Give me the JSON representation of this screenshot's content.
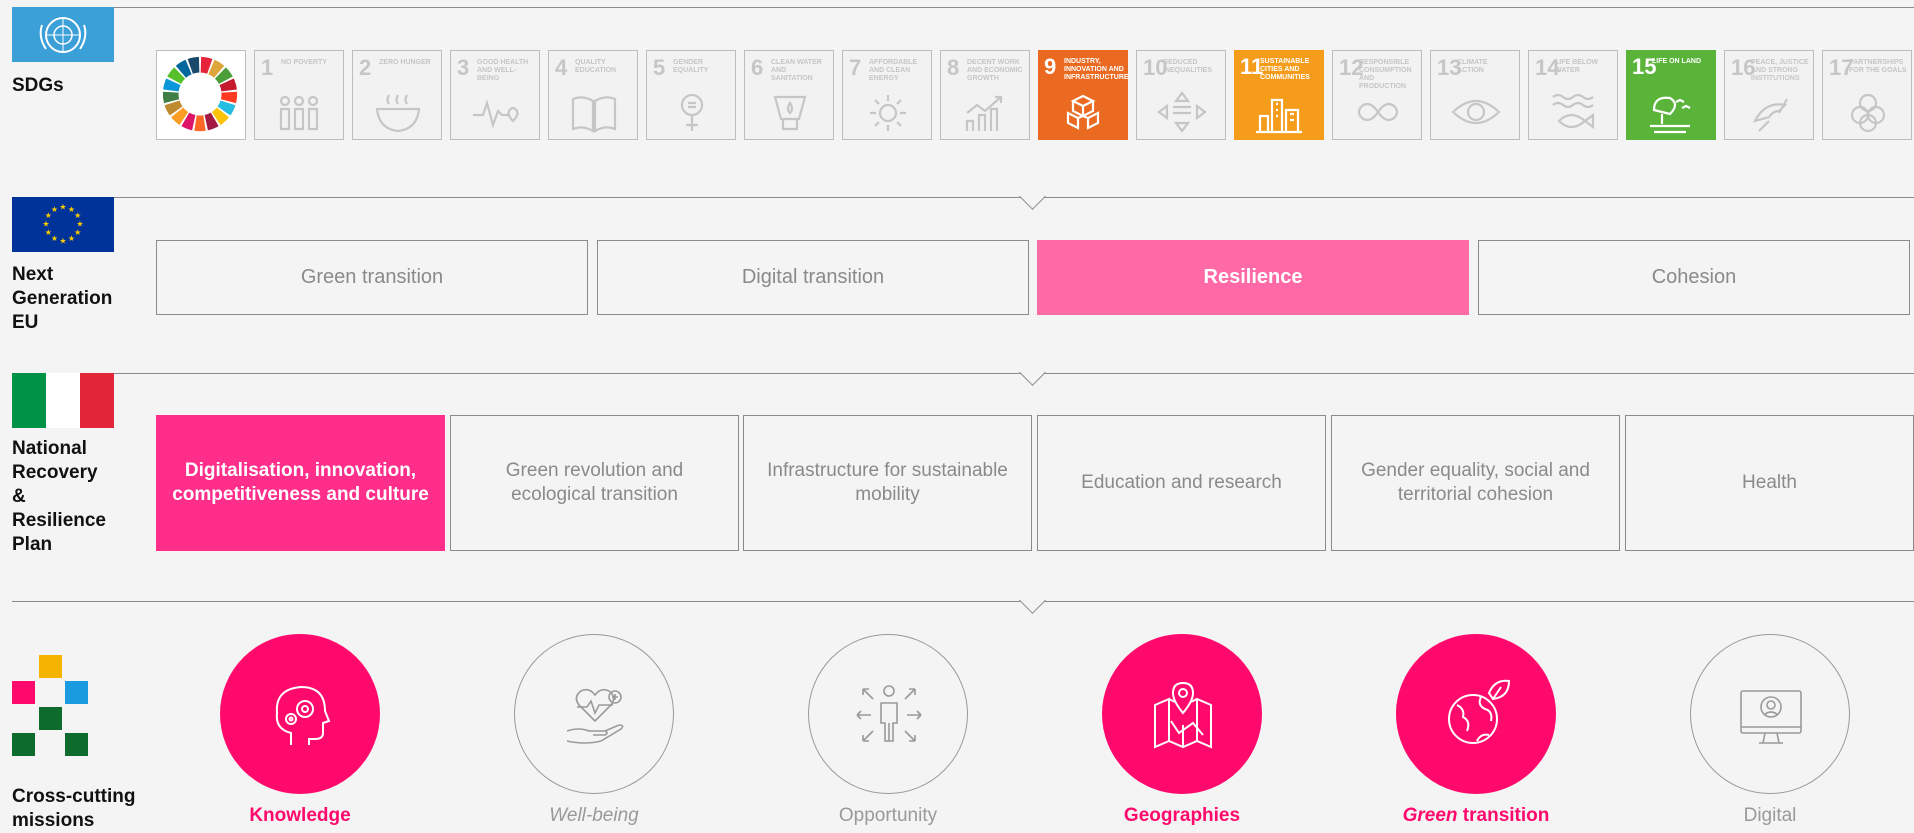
{
  "sections": {
    "sdgs": "SDGs",
    "ngeu": [
      "Next",
      "Generation",
      "EU"
    ],
    "pnrr": [
      "National",
      "Recovery",
      "&",
      "Resilience",
      "Plan"
    ],
    "missions": [
      "Cross-cutting",
      "missions"
    ]
  },
  "sdg_tiles": [
    {
      "num": "1",
      "title": "No poverty",
      "active": false
    },
    {
      "num": "2",
      "title": "Zero hunger",
      "active": false
    },
    {
      "num": "3",
      "title": "Good health and well-being",
      "active": false
    },
    {
      "num": "4",
      "title": "Quality education",
      "active": false
    },
    {
      "num": "5",
      "title": "Gender equality",
      "active": false
    },
    {
      "num": "6",
      "title": "Clean water and sanitation",
      "active": false
    },
    {
      "num": "7",
      "title": "Affordable and clean energy",
      "active": false
    },
    {
      "num": "8",
      "title": "Decent work and economic growth",
      "active": false
    },
    {
      "num": "9",
      "title": "Industry, innovation and infrastructure",
      "active": true,
      "color": "#eb6a22"
    },
    {
      "num": "10",
      "title": "Reduced inequalities",
      "active": false
    },
    {
      "num": "11",
      "title": "Sustainable cities and communities",
      "active": true,
      "color": "#f59c1b"
    },
    {
      "num": "12",
      "title": "Responsible consumption and production",
      "active": false
    },
    {
      "num": "13",
      "title": "Climate action",
      "active": false
    },
    {
      "num": "14",
      "title": "Life below water",
      "active": false
    },
    {
      "num": "15",
      "title": "Life on land",
      "active": true,
      "color": "#5bb43a"
    },
    {
      "num": "16",
      "title": "Peace, justice and strong institutions",
      "active": false
    },
    {
      "num": "17",
      "title": "Partnerships for the goals",
      "active": false
    }
  ],
  "ngeu_items": [
    {
      "label": "Green transition",
      "active": false
    },
    {
      "label": "Digital transition",
      "active": false
    },
    {
      "label": "Resilience",
      "active": true
    },
    {
      "label": "Cohesion",
      "active": false
    }
  ],
  "pnrr_items": [
    {
      "label": "Digitalisation, innovation, competitiveness and culture",
      "active": true
    },
    {
      "label": "Green revolution and ecological transition",
      "active": false
    },
    {
      "label": "Infrastructure for sustainable mobility",
      "active": false
    },
    {
      "label": "Education and research",
      "active": false
    },
    {
      "label": "Gender equality, social and territorial cohesion",
      "active": false
    },
    {
      "label": "Health",
      "active": false
    }
  ],
  "missions": [
    {
      "label": "Knowledge",
      "icon": "head-gears-icon",
      "active": true
    },
    {
      "label": "Well-being",
      "icon": "heart-hand-icon",
      "active": false
    },
    {
      "label": "Opportunity",
      "icon": "person-arrows-icon",
      "active": false
    },
    {
      "label": "Geographies",
      "icon": "map-pin-icon",
      "active": true
    },
    {
      "label_em": "Green",
      "label_rest": " transition",
      "icon": "globe-leaf-icon",
      "active": true
    },
    {
      "label": "Digital",
      "icon": "monitor-user-icon",
      "active": false
    }
  ],
  "colors": {
    "accent": "#ff0a6c",
    "resilience": "#ff69a6",
    "pnrr_active": "#ff2e8a",
    "eu_blue": "#003399",
    "un_blue": "#3b9fd8"
  }
}
